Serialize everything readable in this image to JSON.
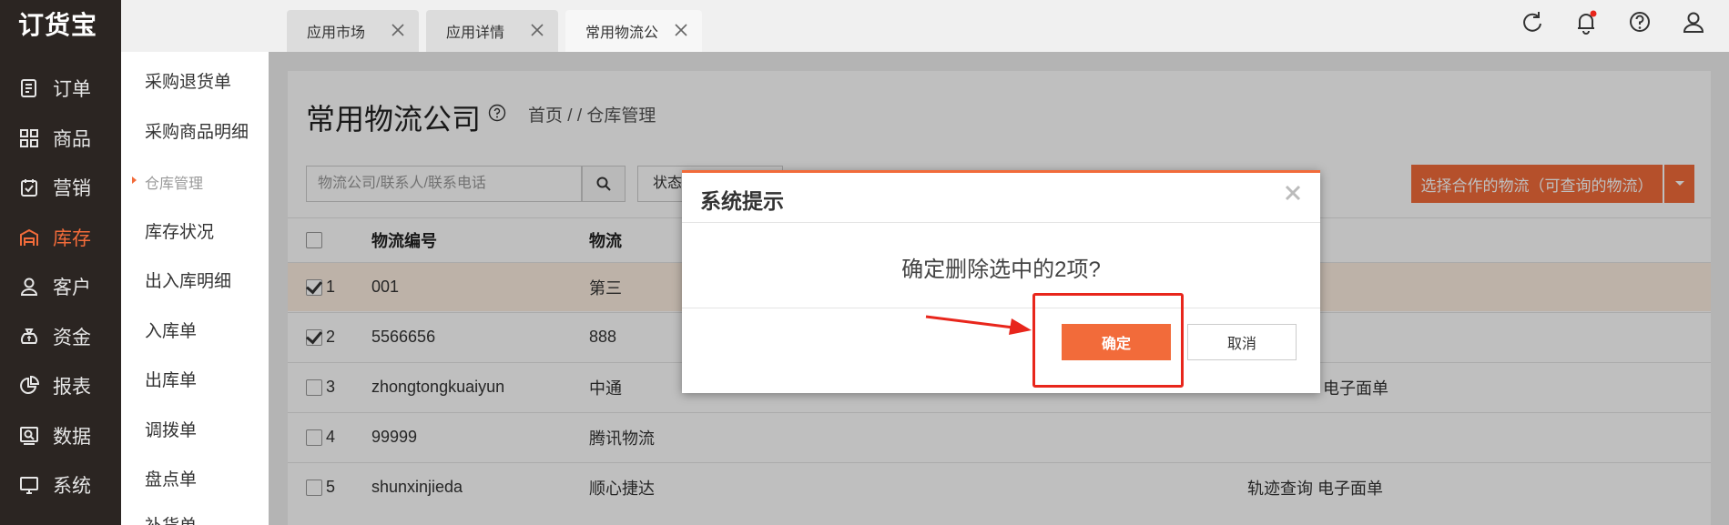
{
  "app": {
    "logo": "订货宝"
  },
  "colors": {
    "accent": "#f26b3a",
    "nav_bg": "#2b2522",
    "annotation": "#e8261c"
  },
  "nav": {
    "items": [
      {
        "label": "订单",
        "icon": "order-icon"
      },
      {
        "label": "商品",
        "icon": "goods-icon"
      },
      {
        "label": "营销",
        "icon": "marketing-icon"
      },
      {
        "label": "库存",
        "icon": "warehouse-icon",
        "active": true
      },
      {
        "label": "客户",
        "icon": "customer-icon"
      },
      {
        "label": "资金",
        "icon": "money-bag-icon"
      },
      {
        "label": "报表",
        "icon": "pie-chart-icon"
      },
      {
        "label": "数据",
        "icon": "data-icon"
      },
      {
        "label": "系统",
        "icon": "monitor-icon"
      }
    ]
  },
  "subnav": {
    "items": [
      "采购退货单",
      "采购商品明细",
      "仓库管理",
      "库存状况",
      "出入库明细",
      "入库单",
      "出库单",
      "调拨单",
      "盘点单",
      "补货单"
    ],
    "group_label_index": 2
  },
  "tabs": [
    {
      "label": "应用市场"
    },
    {
      "label": "应用详情"
    },
    {
      "label": "常用物流公",
      "active": true
    }
  ],
  "topbar_icons": [
    "refresh-icon",
    "bell-icon",
    "help-icon",
    "user-icon"
  ],
  "page": {
    "title": "常用物流公司",
    "breadcrumb": "首页 / / 仓库管理",
    "search_placeholder": "物流公司/联系人/联系电话",
    "status_filter": "状态",
    "select_button": "选择合作的物流（可查询的物流）"
  },
  "table": {
    "headers": [
      "",
      "物流编号",
      "物流"
    ],
    "rows": [
      {
        "num": "1",
        "code": "001",
        "name": "第三",
        "extra": "",
        "checked": true,
        "highlight": true
      },
      {
        "num": "2",
        "code": "5566656",
        "name": "888",
        "extra": "",
        "checked": true,
        "highlight": false
      },
      {
        "num": "3",
        "code": "zhongtongkuaiyun",
        "name": "中通",
        "extra": "电子面单",
        "checked": false,
        "highlight": false
      },
      {
        "num": "4",
        "code": "99999",
        "name": "腾讯物流",
        "extra": "",
        "checked": false,
        "highlight": false
      },
      {
        "num": "5",
        "code": "shunxinjieda",
        "name": "顺心捷达",
        "extra": "轨迹查询 电子面单",
        "checked": false,
        "highlight": false
      }
    ]
  },
  "dialog": {
    "title": "系统提示",
    "message": "确定删除选中的2项?",
    "confirm": "确定",
    "cancel": "取消"
  }
}
